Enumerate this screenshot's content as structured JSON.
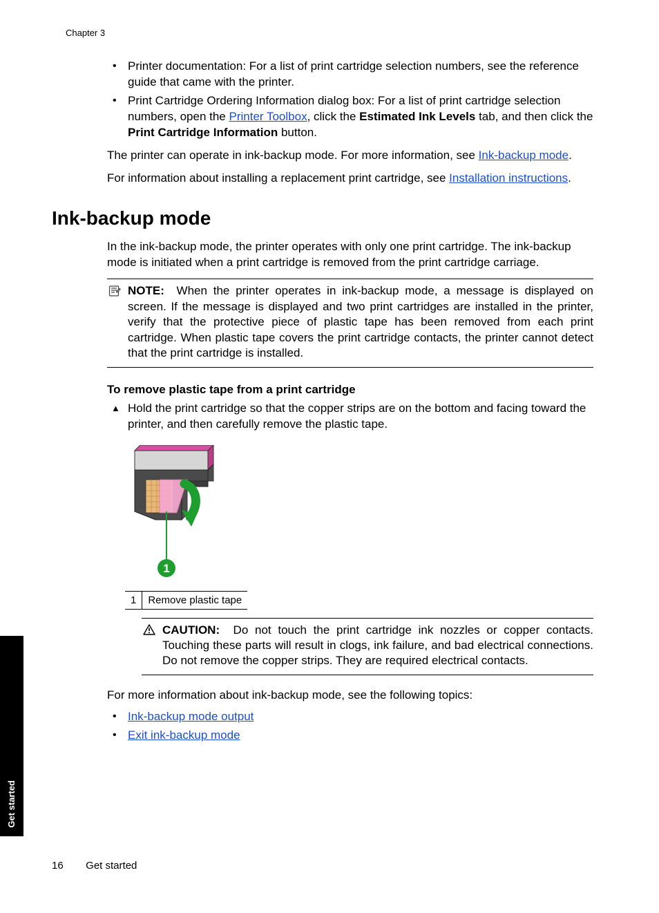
{
  "chapter": "Chapter 3",
  "intro_bullets": {
    "b1": "Printer documentation: For a list of print cartridge selection numbers, see the reference guide that came with the printer.",
    "b2_pre": "Print Cartridge Ordering Information dialog box: For a list of print cartridge selection numbers, open the ",
    "b2_link": "Printer Toolbox",
    "b2_mid1": ", click the ",
    "b2_bold1": "Estimated Ink Levels",
    "b2_mid2": " tab, and then click the ",
    "b2_bold2": "Print Cartridge Information",
    "b2_end": " button."
  },
  "p1": {
    "pre": "The printer can operate in ink-backup mode. For more information, see ",
    "link": "Ink-backup mode",
    "end": "."
  },
  "p2": {
    "pre": "For information about installing a replacement print cartridge, see ",
    "link": "Installation instructions",
    "end": "."
  },
  "heading": "Ink-backup mode",
  "section_intro": "In the ink-backup mode, the printer operates with only one print cartridge. The ink-backup mode is initiated when a print cartridge is removed from the print cartridge carriage.",
  "note": {
    "label": "NOTE:",
    "text": "When the printer operates in ink-backup mode, a message is displayed on screen. If the message is displayed and two print cartridges are installed in the printer, verify that the protective piece of plastic tape has been removed from each print cartridge. When plastic tape covers the print cartridge contacts, the printer cannot detect that the print cartridge is installed."
  },
  "subhead": "To remove plastic tape from a print cartridge",
  "step": "Hold the print cartridge so that the copper strips are on the bottom and facing toward the printer, and then carefully remove the plastic tape.",
  "legend": {
    "num": "1",
    "text": "Remove plastic tape"
  },
  "caution": {
    "label": "CAUTION:",
    "text": "Do not touch the print cartridge ink nozzles or copper contacts. Touching these parts will result in clogs, ink failure, and bad electrical connections. Do not remove the copper strips. They are required electrical contacts."
  },
  "more_info": "For more information about ink-backup mode, see the following topics:",
  "links": {
    "l1": "Ink-backup mode output",
    "l2": "Exit ink-backup mode"
  },
  "side_tab": "Get started",
  "footer": {
    "page": "16",
    "section": "Get started"
  },
  "callout_number": "1"
}
